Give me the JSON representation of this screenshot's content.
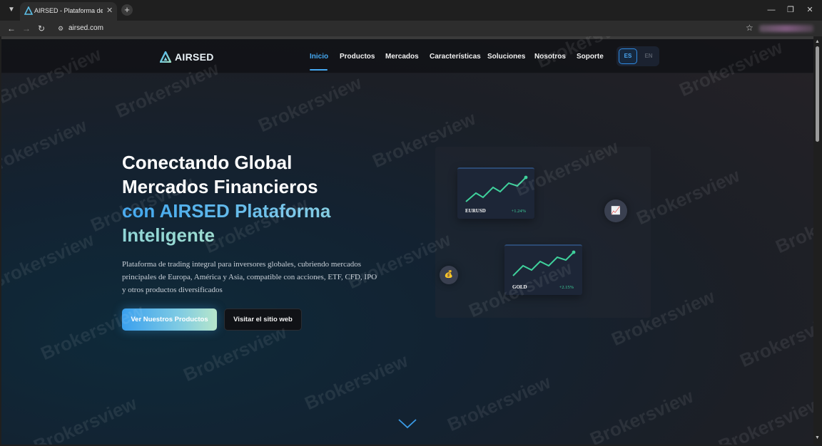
{
  "browser": {
    "tab_title": "AIRSED - Plataforma de Trad",
    "new_tab": "+",
    "close_tab": "✕",
    "address": "airsed.com"
  },
  "site": {
    "logo_text": "AIRSED",
    "nav": [
      "Inicio",
      "Productos",
      "Mercados",
      "Características",
      "Soluciones",
      "Nosotros",
      "Soporte"
    ],
    "active_nav": "Inicio",
    "languages": [
      "ES",
      "EN"
    ],
    "active_language": "ES"
  },
  "hero": {
    "title_line1": "Conectando Global",
    "title_line2": "Mercados Financieros",
    "title_line3": "con AIRSED Plataforma",
    "title_line4": "Inteligente",
    "description": "Plataforma de trading integral para inversores globales, cubriendo mercados principales de Europa, América y Asia, compatible con acciones, ETF, CFD, IPO y otros productos diversificados",
    "primary_button": "Ver Nuestros Productos",
    "secondary_button": "Visitar el sitio web"
  },
  "market_cards": [
    {
      "symbol": "EURUSD",
      "change": "+1.24%"
    },
    {
      "symbol": "GOLD",
      "change": "+2.15%"
    }
  ],
  "icons": {
    "chart": "📈",
    "coin": "💰"
  },
  "watermark_text": "Brokersview",
  "colors": {
    "accent": "#45a9f2",
    "positive": "#3fd19c",
    "background": "#1c1f26"
  }
}
